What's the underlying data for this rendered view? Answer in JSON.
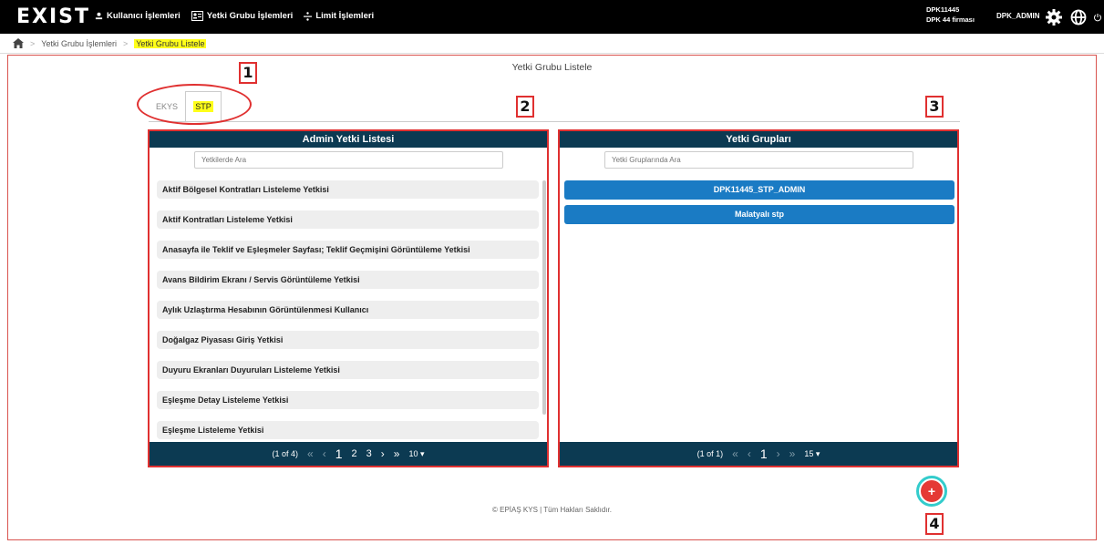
{
  "header": {
    "brand": "EXIST",
    "nav": [
      "Kullanıcı İşlemleri",
      "Yetki Grubu İşlemleri",
      "Limit İşlemleri"
    ],
    "user_line1": "DPK11445",
    "user_line2": "DPK 44 firması",
    "username": "DPK_ADMIN"
  },
  "breadcrumb": {
    "items": [
      "Yetki Grubu İşlemleri",
      "Yetki Grubu Listele"
    ]
  },
  "page_title": "Yetki Grubu Listele",
  "tabs": [
    "EKYS",
    "STP"
  ],
  "left_panel": {
    "title": "Admin Yetki Listesi",
    "search_placeholder": "Yetkilerde Ara",
    "items": [
      "Aktif Bölgesel Kontratları Listeleme Yetkisi",
      "Aktif Kontratları Listeleme Yetkisi",
      "Anasayfa ile Teklif ve Eşleşmeler Sayfası; Teklif Geçmişini Görüntüleme Yetkisi",
      "Avans Bildirim Ekranı / Servis Görüntüleme Yetkisi",
      "Aylık Uzlaştırma Hesabının Görüntülenmesi Kullanıcı",
      "Doğalgaz Piyasası Giriş Yetkisi",
      "Duyuru Ekranları Duyuruları Listeleme Yetkisi",
      "Eşleşme Detay Listeleme Yetkisi",
      "Eşleşme Listeleme Yetkisi"
    ],
    "pager": {
      "info": "(1 of 4)",
      "pages": [
        "1",
        "2",
        "3"
      ],
      "per_page": "10 ▾"
    }
  },
  "right_panel": {
    "title": "Yetki Grupları",
    "search_placeholder": "Yetki Gruplarında Ara",
    "items": [
      "DPK11445_STP_ADMIN",
      "Malatyalı stp"
    ],
    "pager": {
      "info": "(1 of 1)",
      "pages": [
        "1"
      ],
      "per_page": "15 ▾"
    }
  },
  "annotations": [
    "1",
    "2",
    "3",
    "4"
  ],
  "footer": "© EPİAŞ KYS | Tüm Hakları Saklıdır.",
  "colors": {
    "header": "#000000",
    "panel_header": "#0c3a52",
    "group_item": "#1a7bc4",
    "highlight": "#ffff1a",
    "annotation": "#e03030",
    "fab": "#e53935"
  }
}
